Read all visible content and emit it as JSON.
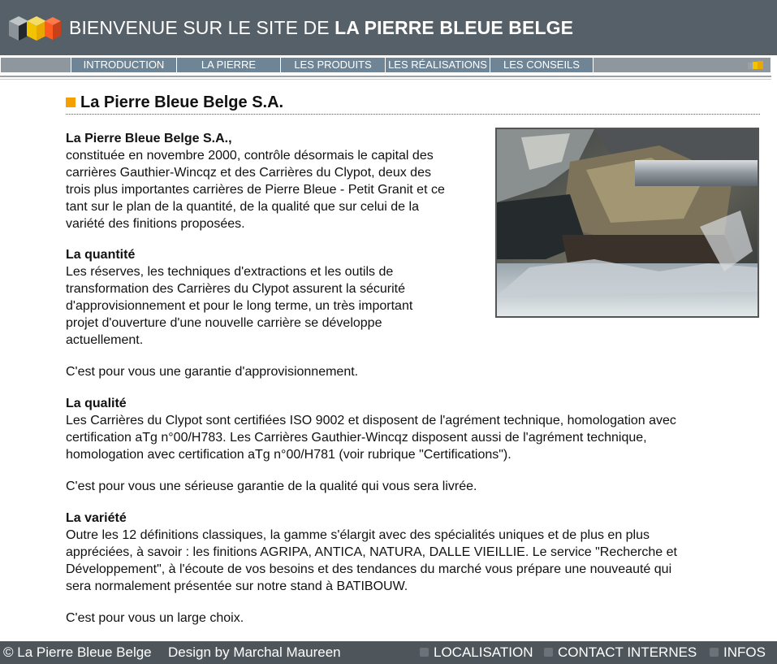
{
  "header": {
    "title_prefix": "BIENVENUE SUR LE SITE DE ",
    "title_bold": "LA PIERRE BLEUE BELGE",
    "logo_icon": "belgian-stone-blocks-logo"
  },
  "nav": {
    "items": [
      {
        "label": "INTRODUCTION"
      },
      {
        "label": "LA PIERRE"
      },
      {
        "label": "LES PRODUITS"
      },
      {
        "label": "LES RÉALISATIONS"
      },
      {
        "label": "LES CONSEILS"
      }
    ],
    "mini_logo_icon": "mini-logo-icon"
  },
  "page": {
    "title": "La Pierre Bleue Belge S.A.",
    "intro_heading": "La Pierre Bleue Belge S.A.,",
    "intro_text_lines": [
      "constituée en novembre 2000, contrôle désormais le capital des",
      "carrières Gauthier-Wincqz et des Carrières du Clypot, deux des",
      "trois plus importantes carrières de Pierre Bleue - Petit Granit et ce",
      "tant sur le plan de la quantité, de la qualité que sur celui de la",
      "variété des finitions proposées."
    ],
    "quantite_heading": "La quantité",
    "quantite_lines": [
      "Les réserves, les techniques d'extractions et les outils de",
      "transformation des Carrières du Clypot assurent la sécurité",
      "d'approvisionnement et pour le long terme, un très important",
      "projet d'ouverture d'une nouvelle carrière se développe",
      "actuellement."
    ],
    "quantite_conclusion": "C'est pour vous une garantie d'approvisionnement.",
    "qualite_heading": "La qualité",
    "qualite_lines": [
      "Les Carrières du Clypot sont certifiées ISO 9002 et disposent de l'agrément technique, homologation avec",
      "certification aTg n°00/H783. Les Carrières Gauthier-Wincqz disposent aussi de l'agrément technique,",
      "homologation avec certification aTg n°00/H781 (voir rubrique \"Certifications\")."
    ],
    "qualite_conclusion": "C'est pour vous une sérieuse garantie de la qualité qui vous sera livrée.",
    "variete_heading": "La variété",
    "variete_lines": [
      "Outre les 12 définitions classiques, la gamme s'élargit avec des spécialités uniques et de plus en plus",
      "appréciées, à savoir : les finitions AGRIPA, ANTICA, NATURA, DALLE VIEILLIE. Le service \"Recherche et",
      "Développement\", à l'écoute de vos besoins et des tendances du marché vous prépare une nouveauté qui",
      "sera normalement présentée sur notre stand à BATIBOUW."
    ],
    "variete_conclusion": "C'est pour vous un large choix.",
    "photo_icon": "quarry-stone-cutting-photo"
  },
  "footer": {
    "copyright": "© La Pierre Bleue Belge",
    "design": "Design by Marchal Maureen",
    "links": [
      {
        "label": "LOCALISATION"
      },
      {
        "label": "CONTACT INTERNES"
      },
      {
        "label": "INFOS"
      }
    ]
  },
  "colors": {
    "header_bg": "#566068",
    "nav_item_bg": "#6f8494",
    "accent_orange": "#f5a000",
    "footer_bg": "#4e565c"
  }
}
